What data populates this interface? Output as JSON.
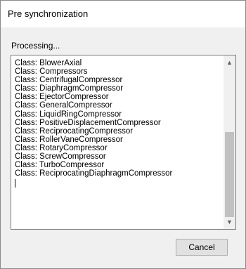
{
  "window": {
    "title": "Pre synchronization"
  },
  "status": {
    "text": "Processing..."
  },
  "log": {
    "lines": [
      "Class: BlowerAxial",
      "Class: Compressors",
      "Class: CentrifugalCompressor",
      "Class: DiaphragmCompressor",
      "Class: EjectorCompressor",
      "Class: GeneralCompressor",
      "Class: LiquidRingCompressor",
      "Class: PositiveDisplacementCompressor",
      "Class: ReciprocatingCompressor",
      "Class: RollerVaneCompressor",
      "Class: RotaryCompressor",
      "Class: ScrewCompressor",
      "Class: TurboCompressor",
      "Class: ReciprocatingDiaphragmCompressor"
    ]
  },
  "buttons": {
    "cancel_label": "Cancel"
  },
  "icons": {
    "scroll_up": "chevron-up-icon",
    "scroll_down": "chevron-down-icon"
  }
}
